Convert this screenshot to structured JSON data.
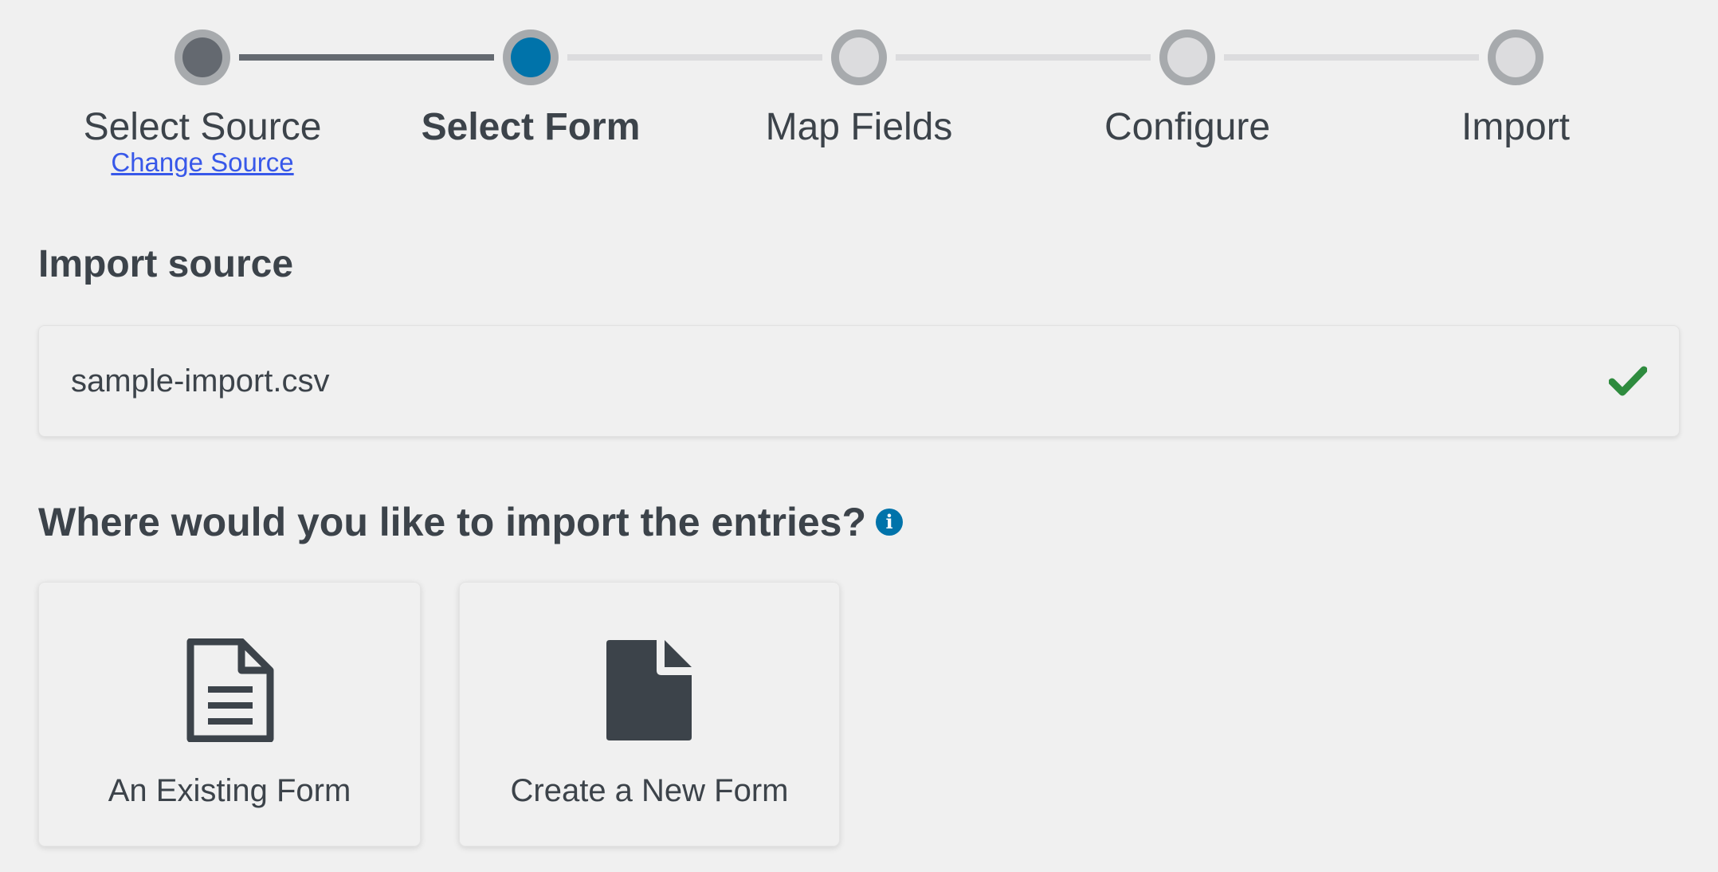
{
  "stepper": {
    "steps": [
      {
        "label": "Select Source",
        "status": "done",
        "link": "Change Source"
      },
      {
        "label": "Select Form",
        "status": "current"
      },
      {
        "label": "Map Fields",
        "status": "pending"
      },
      {
        "label": "Configure",
        "status": "pending"
      },
      {
        "label": "Import",
        "status": "pending"
      }
    ]
  },
  "import_source": {
    "title": "Import source",
    "file_name": "sample-import.csv",
    "status_icon": "check-icon",
    "status_color": "#2e8b3e"
  },
  "destination": {
    "title": "Where would you like to import the entries?",
    "info_icon": "i",
    "options": [
      {
        "label": "An Existing Form",
        "icon": "file-text-icon"
      },
      {
        "label": "Create a New Form",
        "icon": "file-icon"
      }
    ]
  },
  "colors": {
    "accent": "#0073aa",
    "link": "#3858e9",
    "done_step": "#646970",
    "pending_step": "#dcdcde",
    "text": "#3c434a",
    "background": "#f0f0f0"
  }
}
